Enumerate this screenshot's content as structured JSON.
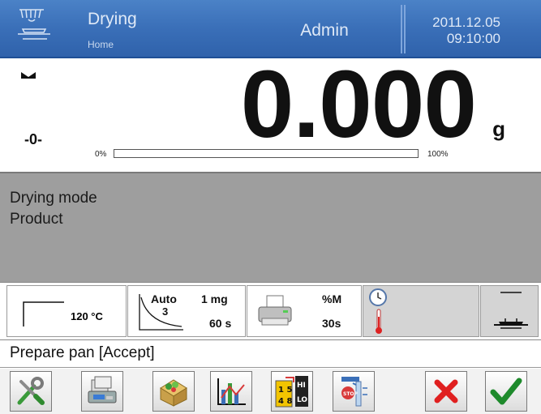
{
  "header": {
    "title": "Drying",
    "subtitle": "Home",
    "user": "Admin",
    "date": "2011.12.05",
    "time": "09:10:00",
    "icon": "drying-weighing-pan-icon"
  },
  "weighing": {
    "stable_icon": "stable-indicator-icon",
    "zero_marker": "-0-",
    "reading": "0.000",
    "unit": "g",
    "bar_min_label": "0%",
    "bar_max_label": "100%",
    "bar_fill_fraction": 0.0
  },
  "info": {
    "line1": "Drying mode",
    "line2": "Product"
  },
  "status": {
    "heating_profile": {
      "icon": "standard-heating-profile-icon",
      "value": "120 °C"
    },
    "finish_mode": {
      "icon": "auto-finish-curve-icon",
      "mode": "Auto",
      "number": "3",
      "delta_mass": "1 mg",
      "delta_time": "60 s"
    },
    "printout": {
      "icon": "printer-icon",
      "unit": "%M",
      "interval": "30s"
    },
    "timer_temp": {
      "icons": [
        "clock-icon",
        "thermometer-icon"
      ]
    },
    "pan": {
      "icon": "pan-status-icon"
    }
  },
  "message": "Prepare pan [Accept]",
  "buttons": [
    {
      "name": "tools-button",
      "icon": "wrench-screwdriver-icon"
    },
    {
      "name": "database-button",
      "icon": "database-icon"
    },
    {
      "name": "products-button",
      "icon": "product-box-icon"
    },
    {
      "name": "graph-button",
      "icon": "chart-icon"
    },
    {
      "name": "hi-lo-button",
      "icon": "hi-lo-icon"
    },
    {
      "name": "stop-mode-button",
      "icon": "stop-mode-icon"
    },
    {
      "name": "cancel-button",
      "icon": "red-x-icon"
    },
    {
      "name": "accept-button",
      "icon": "green-check-icon"
    }
  ],
  "colors": {
    "header_blue": "#3a6fb8",
    "info_gray": "#9e9e9e",
    "cancel_red": "#e02020",
    "accept_green": "#1e8a2c"
  }
}
